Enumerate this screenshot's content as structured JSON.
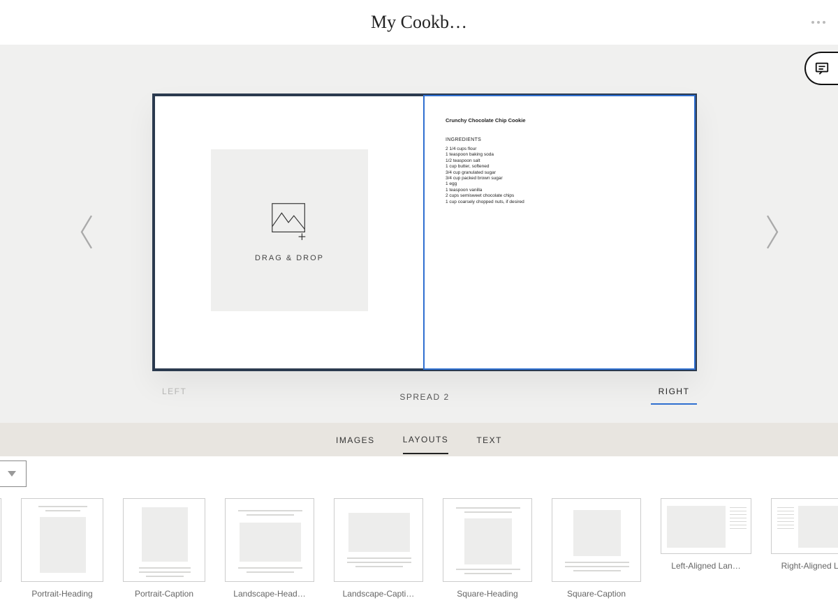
{
  "header": {
    "title": "My Cookb…"
  },
  "editor": {
    "spread_label": "SPREAD 2",
    "page_left_label": "LEFT",
    "page_right_label": "RIGHT",
    "dropzone_label": "DRAG & DROP",
    "recipe": {
      "title": "Crunchy Chocolate Chip Cookie",
      "section": "INGREDIENTS",
      "lines": [
        "2 1/4 cups flour",
        "1 teaspoon baking soda",
        "1/2 teaspoon salt",
        "1 cup butter, softened",
        "3/4 cup granulated sugar",
        "3/4 cup packed brown sugar",
        "1 egg",
        "1 teaspoon vanilla",
        "2 cups semisweet chocolate chips",
        "1 cup coarsely chopped nuts, if desired"
      ]
    }
  },
  "tool_tabs": {
    "images": "IMAGES",
    "layouts": "LAYOUTS",
    "text": "TEXT"
  },
  "layouts": [
    {
      "label": "Portrait-Heading"
    },
    {
      "label": "Portrait-Caption"
    },
    {
      "label": "Landscape-Head…"
    },
    {
      "label": "Landscape-Capti…"
    },
    {
      "label": "Square-Heading"
    },
    {
      "label": "Square-Caption"
    },
    {
      "label": "Left-Aligned Lan…"
    },
    {
      "label": "Right-Aligned La…"
    }
  ]
}
